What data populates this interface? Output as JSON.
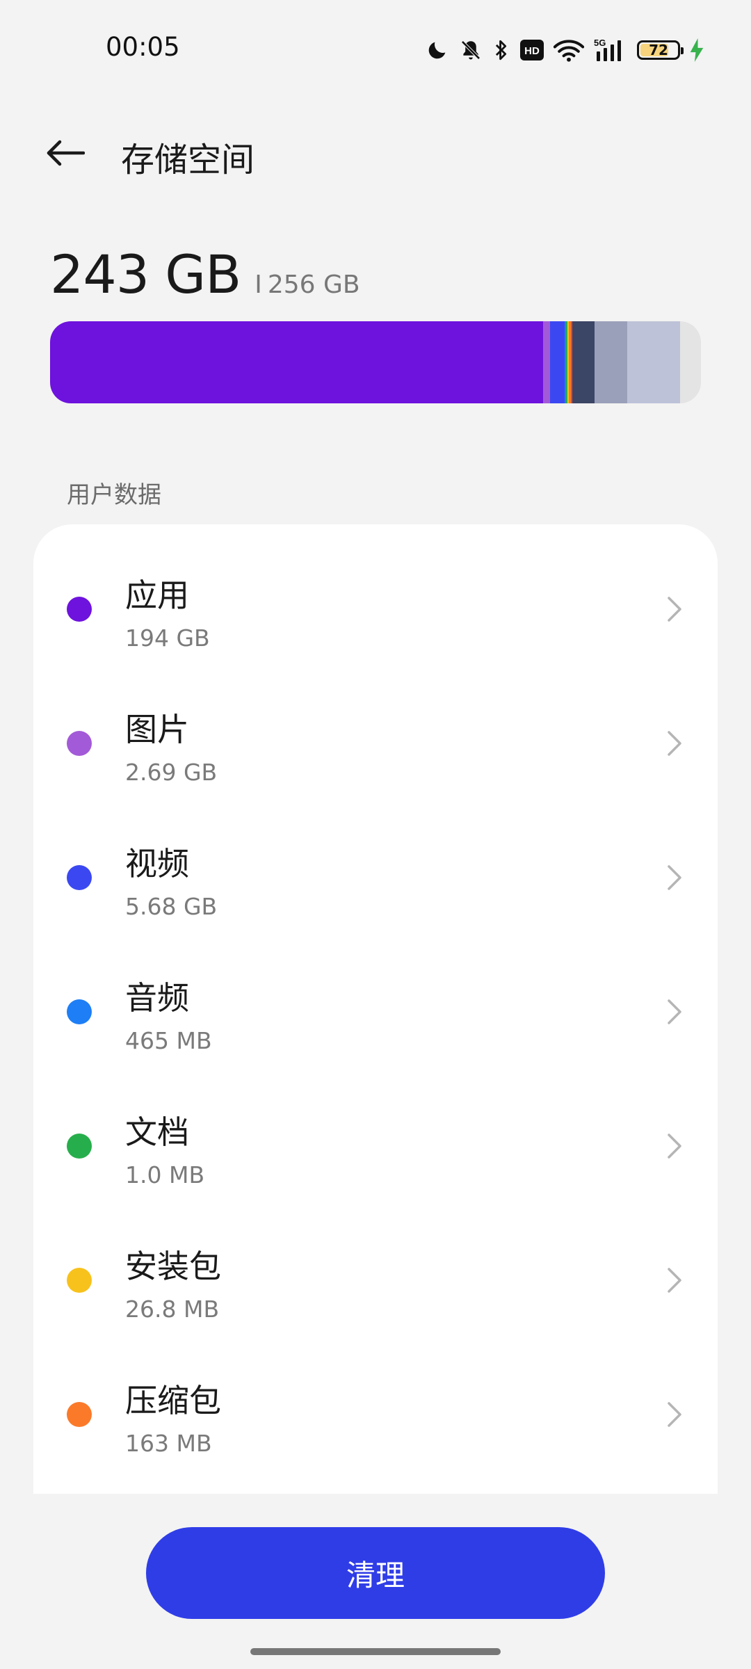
{
  "status_bar": {
    "time": "00:05",
    "battery_level": "72",
    "network": "5G",
    "hd_badge": "HD",
    "icons": [
      "moon-icon",
      "bell-off-icon",
      "bluetooth-icon",
      "hd-icon",
      "wifi-icon",
      "signal-5g-icon",
      "battery-icon",
      "charging-icon"
    ]
  },
  "header": {
    "title": "存储空间",
    "back_icon": "arrow-left-icon"
  },
  "summary": {
    "used": "243 GB",
    "separator": "I",
    "total": "256 GB"
  },
  "storage_bar": {
    "capacity_gb": 256,
    "segments": [
      {
        "name": "apps",
        "color": "#6e12de",
        "value_gb": 194
      },
      {
        "name": "images",
        "color": "#a35ad8",
        "value_gb": 2.69
      },
      {
        "name": "videos",
        "color": "#3b48f1",
        "value_gb": 5.68
      },
      {
        "name": "audio",
        "color": "#1e7ef6",
        "value_gb": 0.6
      },
      {
        "name": "documents",
        "color": "#27ae4c",
        "value_gb": 0.6
      },
      {
        "name": "packages",
        "color": "#f8c21c",
        "value_gb": 0.6
      },
      {
        "name": "archives",
        "color": "#fb7a2a",
        "value_gb": 0.6
      },
      {
        "name": "other-red",
        "color": "#e8463c",
        "value_gb": 0.6
      },
      {
        "name": "dark",
        "color": "#3b4565",
        "value_gb": 8.7
      },
      {
        "name": "system",
        "color": "#9aa0b9",
        "value_gb": 12.9
      },
      {
        "name": "other",
        "color": "#bdc2d8",
        "value_gb": 20.8
      }
    ]
  },
  "section": {
    "title": "用户数据"
  },
  "items": [
    {
      "title": "应用",
      "size": "194 GB",
      "color": "#6e12de"
    },
    {
      "title": "图片",
      "size": "2.69 GB",
      "color": "#a35ad8"
    },
    {
      "title": "视频",
      "size": "5.68 GB",
      "color": "#3b48f1"
    },
    {
      "title": "音频",
      "size": "465 MB",
      "color": "#1e7ef6"
    },
    {
      "title": "文档",
      "size": "1.0 MB",
      "color": "#27ae4c"
    },
    {
      "title": "安装包",
      "size": "26.8 MB",
      "color": "#f8c21c"
    },
    {
      "title": "压缩包",
      "size": "163 MB",
      "color": "#fb7a2a"
    }
  ],
  "actions": {
    "clean_label": "清理",
    "accent_color": "#2f3de7"
  }
}
